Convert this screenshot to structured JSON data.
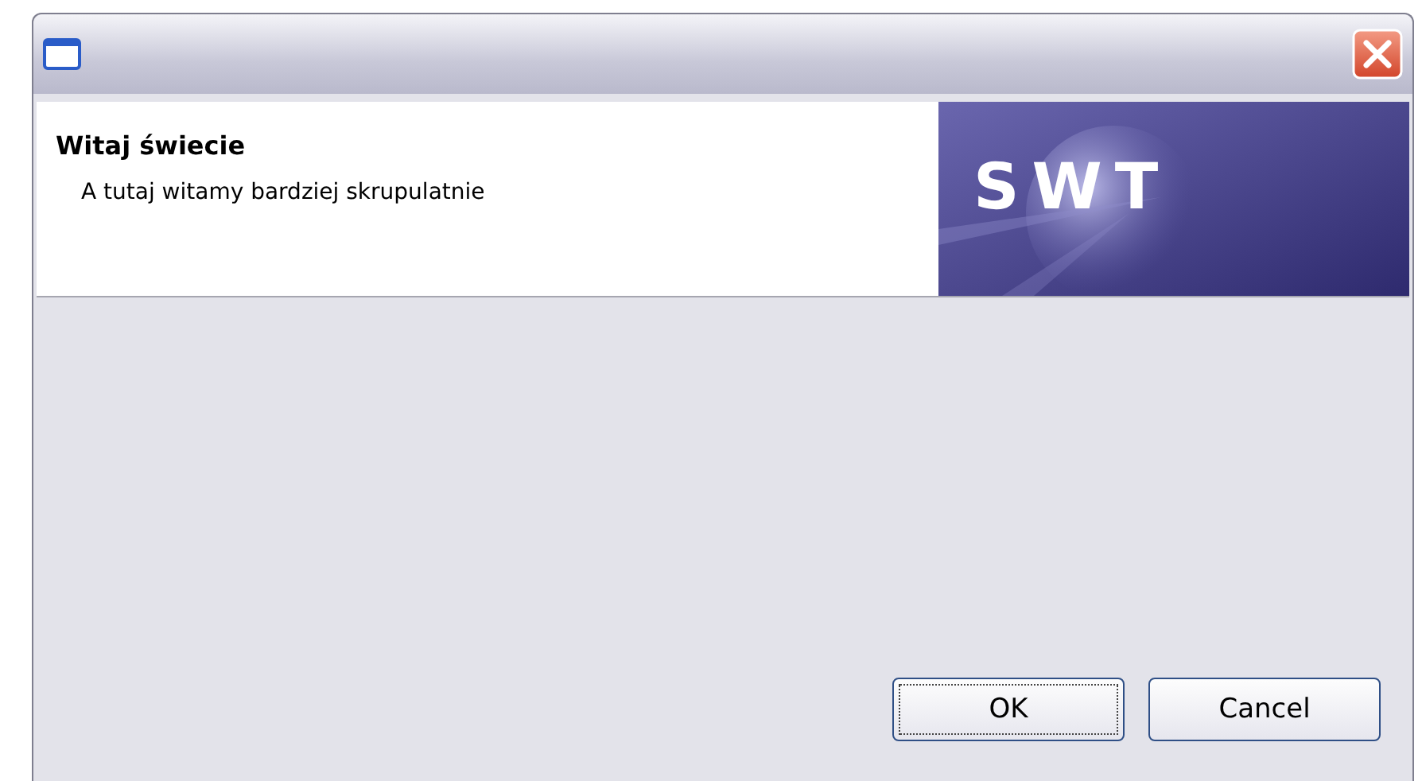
{
  "banner": {
    "title": "Witaj świecie",
    "message": "A tutaj witamy bardziej skrupulatnie",
    "logo": "SWT"
  },
  "buttons": [
    {
      "label": "OK",
      "focused": true
    },
    {
      "label": "Cancel",
      "focused": false
    }
  ]
}
